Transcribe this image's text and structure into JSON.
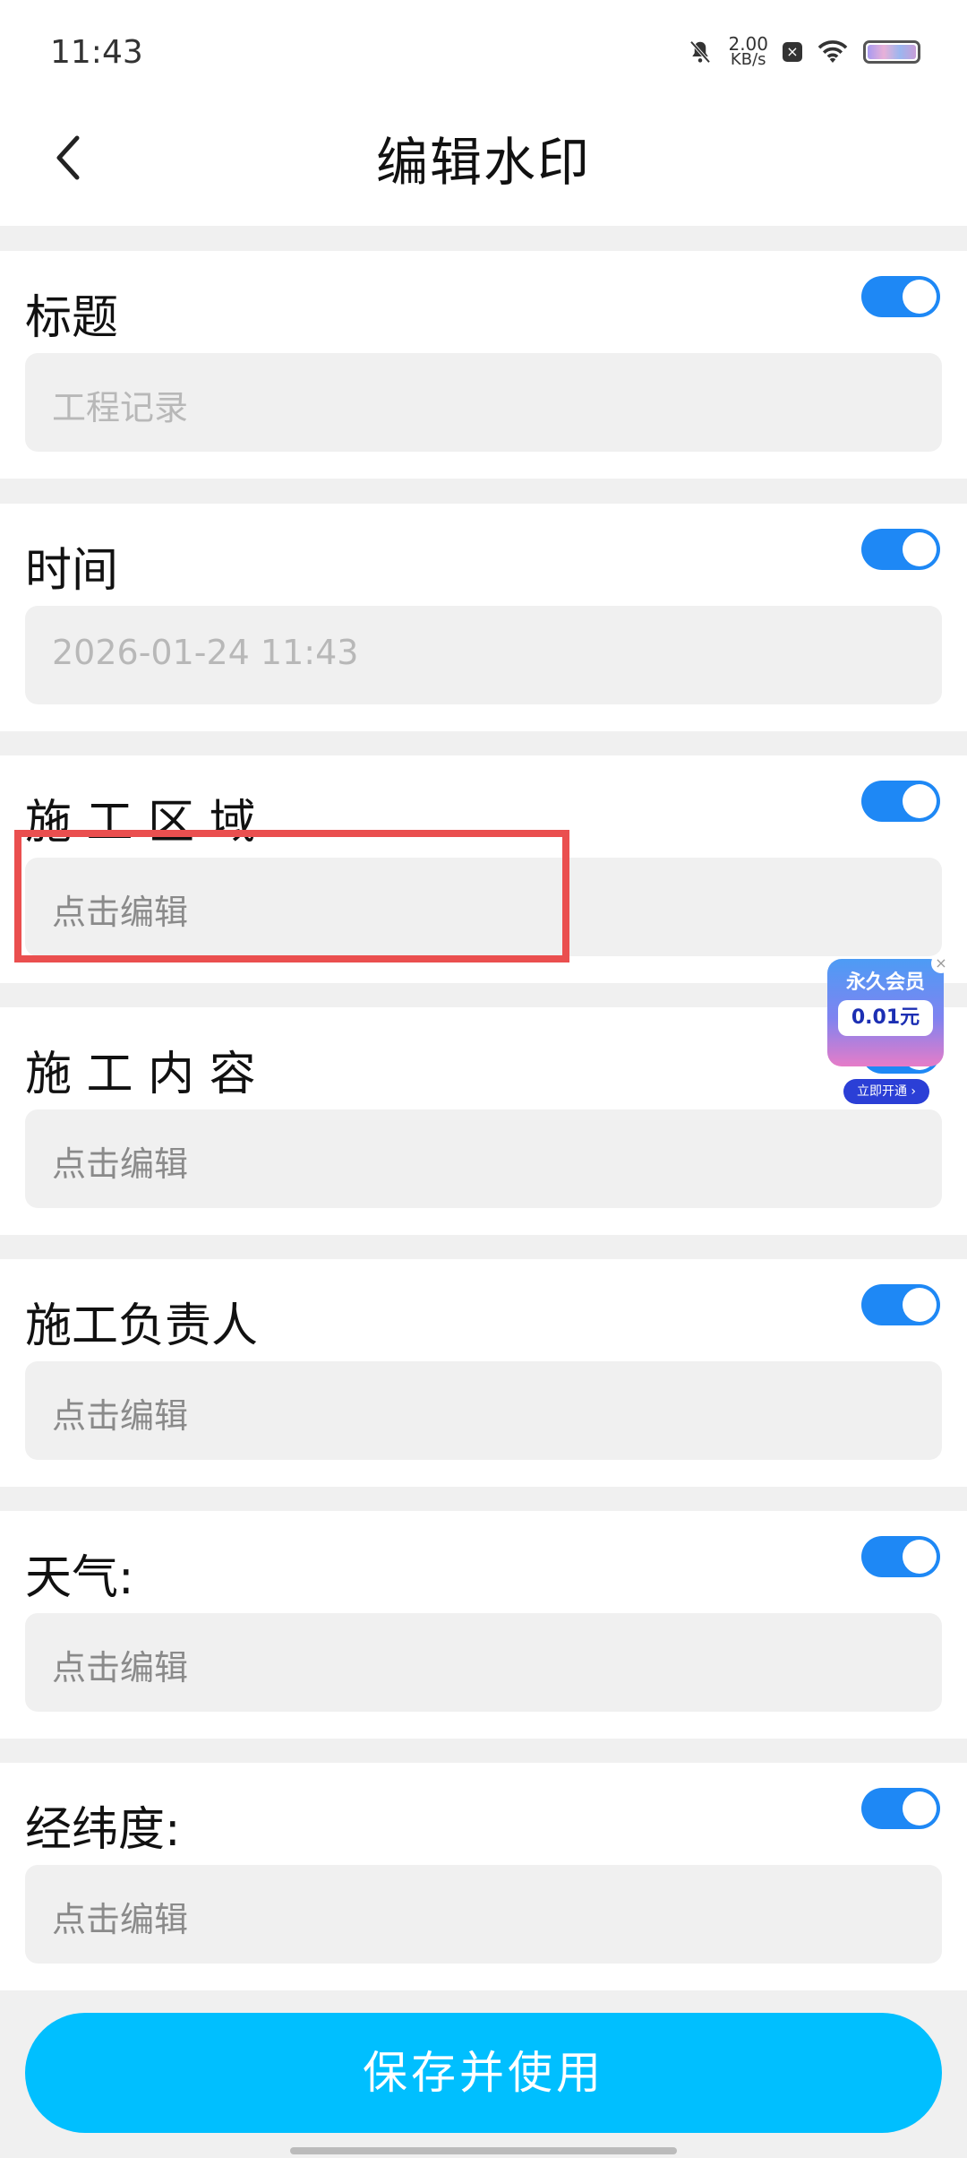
{
  "status_bar": {
    "time": "11:43",
    "speed_value": "2.00",
    "speed_unit": "KB/s"
  },
  "header": {
    "title": "编辑水印"
  },
  "fields": [
    {
      "label": "标题",
      "placeholder": "工程记录",
      "enabled": true
    },
    {
      "label": "时间",
      "placeholder": "2026-01-24 11:43",
      "enabled": true
    },
    {
      "label": "施 工 区 域",
      "placeholder": "点击编辑",
      "enabled": true
    },
    {
      "label": "施 工 内 容",
      "placeholder": "点击编辑",
      "enabled": true
    },
    {
      "label": "施工负责人",
      "placeholder": "点击编辑",
      "enabled": true
    },
    {
      "label": "天气:",
      "placeholder": "点击编辑",
      "enabled": true
    },
    {
      "label": "经纬度:",
      "placeholder": "点击编辑",
      "enabled": true
    }
  ],
  "promo": {
    "title": "永久会员",
    "price": "0.01元",
    "button": "立即开通 ›",
    "close": "×"
  },
  "save_button": "保存并使用",
  "colors": {
    "toggle_on": "#1e88f5",
    "save_button": "#00bfff",
    "highlight": "#ea4f4f"
  }
}
